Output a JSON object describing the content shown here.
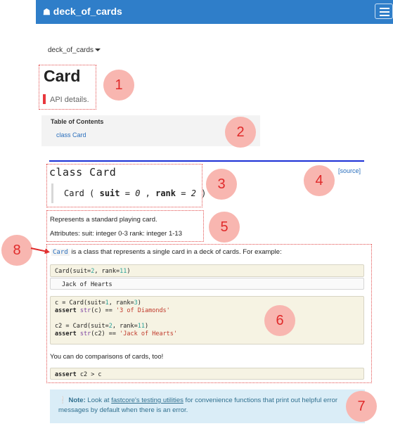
{
  "navbar": {
    "home_icon": "home-icon",
    "title": "deck_of_cards",
    "menu_icon": "hamburger-icon"
  },
  "dropdown": {
    "label": "deck_of_cards"
  },
  "page": {
    "title": "Card",
    "subtitle": "API details."
  },
  "toc": {
    "title": "Table of Contents",
    "link": "class Card"
  },
  "source_link": "[source]",
  "signature": {
    "class_line": "class Card",
    "name": "Card",
    "param1": "suit",
    "val1": "0",
    "param2": "rank",
    "val2": "2"
  },
  "docstring": {
    "line1": "Represents a standard playing card.",
    "line2": "Attributes: suit: integer 0-3 rank: integer 1-13"
  },
  "intro": {
    "code": "Card",
    "text": " is a class that represents a single card in a deck of cards. For example:"
  },
  "code1": {
    "prefix": "Card(suit=",
    "n1": "2",
    "mid": ", rank=",
    "n2": "11",
    "suffix": ")"
  },
  "output1": "Jack of Hearts",
  "code2": {
    "l1a": "c = Card(suit=",
    "l1n1": "1",
    "l1b": ", rank=",
    "l1n2": "3",
    "l1c": ")",
    "l2kw": "assert",
    "l2fn": "str",
    "l2a": "(c) == ",
    "l2s": "'3 of Diamonds'",
    "l3a": "c2 = Card(suit=",
    "l3n1": "2",
    "l3b": ", rank=",
    "l3n2": "11",
    "l3c": ")",
    "l4kw": "assert",
    "l4fn": "str",
    "l4a": "(c2) == ",
    "l4s": "'Jack of Hearts'"
  },
  "para": "You can do comparisons of cards, too!",
  "code3": {
    "kw": "assert",
    "rest": " c2 > c"
  },
  "note": {
    "icon": "info-icon",
    "bold": "Note:",
    "pre": " Look at ",
    "link": "fastcore's testing utilities",
    "post": " for convenience functions that print out helpful error messages by default when there is an error."
  },
  "annotations": [
    "1",
    "2",
    "3",
    "4",
    "5",
    "6",
    "7",
    "8"
  ],
  "colors": {
    "navbar": "#2f7ec9",
    "annotation": "#e02a2a",
    "annotation_fill": "#f8b6b0",
    "rule": "#1a2fd6"
  }
}
